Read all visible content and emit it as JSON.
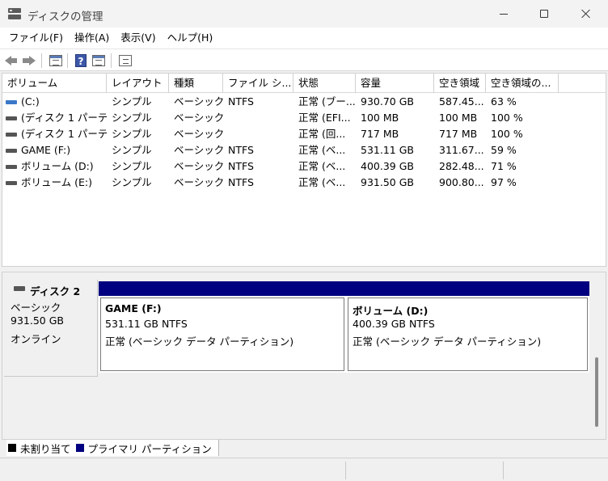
{
  "window": {
    "title": "ディスクの管理"
  },
  "menu": [
    "ファイル(F)",
    "操作(A)",
    "表示(V)",
    "ヘルプ(H)"
  ],
  "toolbar": {
    "help_glyph": "?"
  },
  "columns": [
    "ボリューム",
    "レイアウト",
    "種類",
    "ファイル シ...",
    "状態",
    "容量",
    "空き領域",
    "空き領域の..."
  ],
  "volumes": [
    {
      "name": "(C:)",
      "layout": "シンプル",
      "type": "ベーシック",
      "fs": "NTFS",
      "status": "正常 (ブー...",
      "capacity": "930.70 GB",
      "free": "587.45...",
      "pct": "63 %",
      "system": true
    },
    {
      "name": "(ディスク 1 パーテ...",
      "layout": "シンプル",
      "type": "ベーシック",
      "fs": "",
      "status": "正常 (EFI...",
      "capacity": "100 MB",
      "free": "100 MB",
      "pct": "100 %",
      "system": false
    },
    {
      "name": "(ディスク 1 パーテ...",
      "layout": "シンプル",
      "type": "ベーシック",
      "fs": "",
      "status": "正常 (回...",
      "capacity": "717 MB",
      "free": "717 MB",
      "pct": "100 %",
      "system": false
    },
    {
      "name": "GAME (F:)",
      "layout": "シンプル",
      "type": "ベーシック",
      "fs": "NTFS",
      "status": "正常 (ベ...",
      "capacity": "531.11 GB",
      "free": "311.67...",
      "pct": "59 %",
      "system": false
    },
    {
      "name": "ボリューム (D:)",
      "layout": "シンプル",
      "type": "ベーシック",
      "fs": "NTFS",
      "status": "正常 (ベ...",
      "capacity": "400.39 GB",
      "free": "282.48...",
      "pct": "71 %",
      "system": false
    },
    {
      "name": "ボリューム (E:)",
      "layout": "シンプル",
      "type": "ベーシック",
      "fs": "NTFS",
      "status": "正常 (ベ...",
      "capacity": "931.50 GB",
      "free": "900.80...",
      "pct": "97 %",
      "system": false
    }
  ],
  "disk": {
    "name": "ディスク 2",
    "type": "ベーシック",
    "size": "931.50 GB",
    "status": "オンライン",
    "partitions": [
      {
        "name": "GAME  (F:)",
        "size": "531.11 GB NTFS",
        "status": "正常 (ベーシック データ パーティション)"
      },
      {
        "name": "ボリューム  (D:)",
        "size": "400.39 GB NTFS",
        "status": "正常 (ベーシック データ パーティション)"
      }
    ]
  },
  "legend": [
    {
      "label": "未割り当て",
      "color": "#000000"
    },
    {
      "label": "プライマリ パーティション",
      "color": "#000080"
    }
  ],
  "colors": {
    "partition_bar": "#000080",
    "system_volume_icon": "#3a78c8"
  }
}
